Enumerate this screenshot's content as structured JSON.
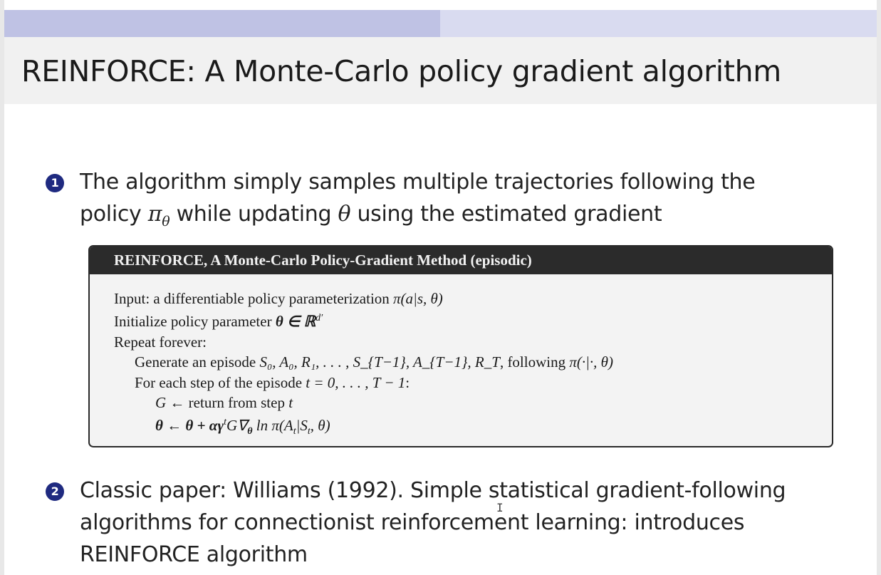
{
  "theme": {
    "progress_filled": "#bfc2e4",
    "progress_rest": "#d9dbf0",
    "bullet_color": "#1f2a80",
    "title_bg": "#f1f1f1"
  },
  "title": "REINFORCE: A Monte-Carlo policy gradient algorithm",
  "bullets": [
    {
      "number": "1",
      "line1": "The algorithm simply samples multiple trajectories following the",
      "line2_pre": "policy ",
      "line2_pi": "π",
      "line2_sub": "θ",
      "line2_mid": " while updating ",
      "line2_theta": "θ",
      "line2_post": " using the estimated gradient"
    },
    {
      "number": "2",
      "line1": "Classic paper: Williams (1992). Simple statistical gradient-following",
      "line2": "algorithms for connectionist reinforcement learning: introduces",
      "line3": "REINFORCE algorithm"
    }
  ],
  "algorithm": {
    "header": "REINFORCE, A Monte-Carlo Policy-Gradient Method (episodic)",
    "lines": [
      {
        "text": "Input: a differentiable policy parameterization ",
        "math": "π(a|s, θ)"
      },
      {
        "text": "Initialize policy parameter ",
        "math": "θ ∈ ℝ",
        "sup": "d′"
      },
      {
        "text": "Repeat forever:"
      },
      {
        "text": "Generate an episode ",
        "math": "S₀, A₀, R₁, . . . , S_{T−1}, A_{T−1}, R_T",
        "post": ", following ",
        "math2": "π(·|·, θ)"
      },
      {
        "text": "For each step of the episode ",
        "math": "t = 0, . . . , T − 1",
        "post": ":"
      },
      {
        "math": "G",
        "text": " ← return from step ",
        "math2": "t"
      },
      {
        "math": "θ ← θ + αγ",
        "sup": "t",
        "math2": "G∇",
        "sub": "θ",
        "post": " ln π(A",
        "sub2": "t",
        "post2": "|S",
        "sub3": "t",
        "post3": ", θ)"
      }
    ]
  }
}
